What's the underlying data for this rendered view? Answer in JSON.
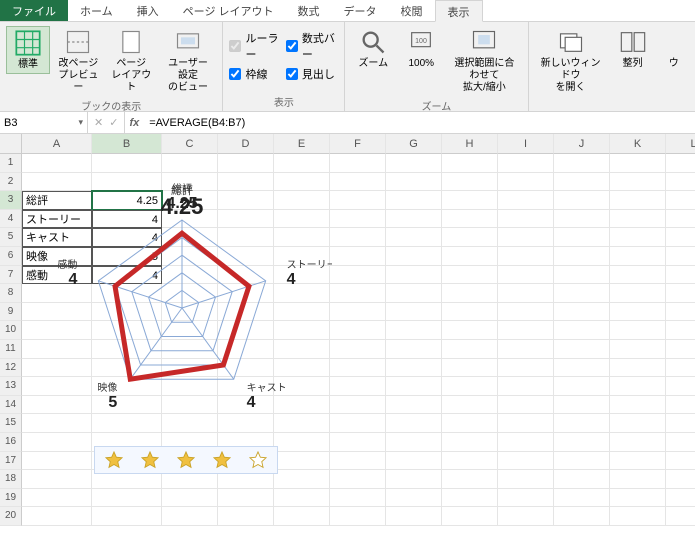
{
  "tabs": {
    "file": "ファイル",
    "home": "ホーム",
    "insert": "挿入",
    "pagelayout": "ページ レイアウト",
    "formulas": "数式",
    "data": "データ",
    "review": "校閲",
    "view": "表示"
  },
  "ribbon": {
    "normal": "標準",
    "pagebreak": "改ページ\nプレビュー",
    "pagelayout": "ページ\nレイアウト",
    "custom": "ユーザー設定\nのビュー",
    "group1": "ブックの表示",
    "ruler": "ルーラー",
    "formulabar": "数式バー",
    "gridlines": "枠線",
    "headings": "見出し",
    "group2": "表示",
    "zoom": "ズーム",
    "zoom100": "100%",
    "zoomsel": "選択範囲に合わせて\n拡大/縮小",
    "group3": "ズーム",
    "newwin": "新しいウィンドウ\nを開く",
    "arrange": "整列",
    "freeze": "ウ"
  },
  "namebox": "B3",
  "formula": "=AVERAGE(B4:B7)",
  "cols": [
    "A",
    "B",
    "C",
    "D",
    "E",
    "F",
    "G",
    "H",
    "I",
    "J",
    "K",
    "L"
  ],
  "rows": [
    "1",
    "2",
    "3",
    "4",
    "5",
    "6",
    "7",
    "8",
    "9",
    "10",
    "11",
    "12",
    "13",
    "14",
    "15",
    "16",
    "17",
    "18",
    "19",
    "20"
  ],
  "cells": {
    "A3": "総評",
    "B3": "4.25",
    "A4": "ストーリー",
    "B4": "4",
    "A5": "キャスト",
    "B5": "4",
    "A6": "映像",
    "B6": "5",
    "A7": "感動",
    "B7": "4"
  },
  "chart_data": {
    "type": "radar",
    "title": "総評",
    "title_value": "4.25",
    "categories": [
      "総評",
      "ストーリー",
      "キャスト",
      "映像",
      "感動"
    ],
    "values": [
      4.25,
      4,
      4,
      5,
      4
    ],
    "max": 5,
    "rings": 5,
    "stars": {
      "filled": 4,
      "total": 5
    }
  }
}
